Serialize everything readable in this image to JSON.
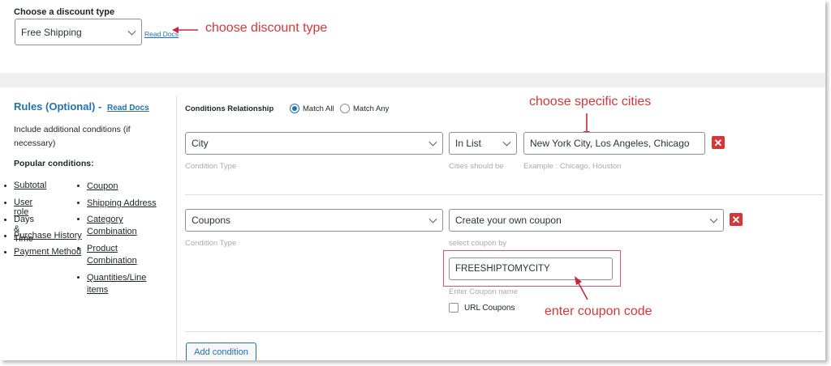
{
  "discount": {
    "heading": "Choose a discount type",
    "selected": "Free Shipping",
    "read_docs": "Read Docs",
    "annotation": "choose discount type"
  },
  "rules": {
    "title": "Rules (Optional) -",
    "read_docs": "Read Docs",
    "description": "Include additional conditions (if necessary)",
    "popular_heading": "Popular conditions:",
    "col1": [
      "Subtotal",
      "User role",
      "Days & Time",
      "Purchase History",
      "Payment Method"
    ],
    "col1_link": [
      true,
      true,
      false,
      true,
      true
    ],
    "col2": [
      "Coupon",
      "Shipping Address",
      "Category Combination",
      "Product Combination",
      "Quantities/Line items"
    ]
  },
  "conditions": {
    "relationship_label": "Conditions Relationship",
    "match_all": "Match All",
    "match_any": "Match Any",
    "selected_match": "all",
    "row1": {
      "type": "City",
      "type_hint": "Condition Type",
      "operator": "In List",
      "operator_hint": "Cities should be",
      "value": "New York City, Los Angeles, Chicago",
      "value_hint": "Example : Chicago, Houston",
      "annotation": "choose specific cities"
    },
    "row2": {
      "type": "Coupons",
      "type_hint": "Condition Type",
      "operator": "Create your own coupon",
      "operator_hint": "select coupon by",
      "coupon_value": "FREESHIPTOMYCITY",
      "coupon_hint": "Enter Coupon name",
      "url_coupons": "URL Coupons",
      "annotation": "enter coupon code"
    },
    "add_condition": "Add condition",
    "remove_symbol": "✕"
  },
  "colors": {
    "annotation": "#d63638",
    "link": "#2271b1",
    "heading_blue": "#2271b1"
  }
}
